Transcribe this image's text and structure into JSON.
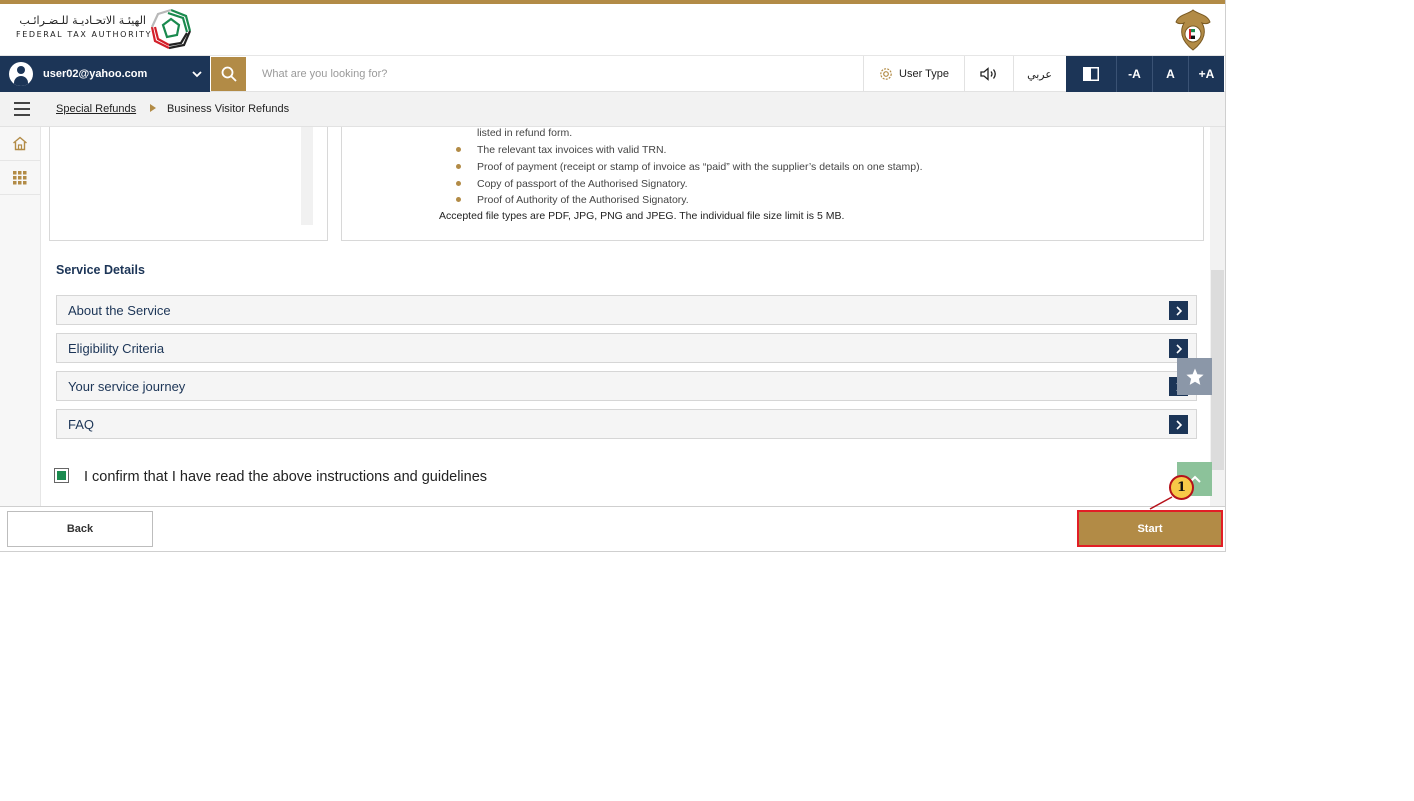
{
  "header": {
    "logo_ar": "الهيئـة الاتحـاديـة للـضـرائـب",
    "logo_en": "FEDERAL TAX AUTHORITY"
  },
  "toolbar": {
    "user_email": "user02@yahoo.com",
    "search_placeholder": "What are you looking for?",
    "user_type_label": "User Type",
    "language_label": "عربي",
    "font_decrease": "-A",
    "font_normal": "A",
    "font_increase": "+A"
  },
  "breadcrumb": {
    "parent": "Special Refunds",
    "current": "Business Visitor Refunds"
  },
  "documents": {
    "continued_line": "listed in refund form.",
    "items": [
      "The relevant tax invoices with valid TRN.",
      "Proof of payment (receipt or stamp of invoice as “paid” with the supplier’s details on one stamp).",
      "Copy of passport of the Authorised Signatory.",
      "Proof of Authority of the Authorised Signatory."
    ],
    "note": "Accepted file types are PDF, JPG, PNG and JPEG. The individual file size limit is 5 MB."
  },
  "service_details": {
    "title": "Service Details",
    "sections": [
      "About the Service",
      "Eligibility Criteria",
      "Your service journey",
      "FAQ"
    ]
  },
  "confirm": {
    "label": "I confirm that I have read the above instructions and guidelines",
    "checked": true
  },
  "footer": {
    "back_label": "Back",
    "start_label": "Start"
  },
  "annotation": {
    "step_number": "1"
  },
  "colors": {
    "brand_gold": "#b28b46",
    "navy": "#1c3557",
    "highlight_red": "#e21e26",
    "check_green": "#1a8a4e"
  }
}
